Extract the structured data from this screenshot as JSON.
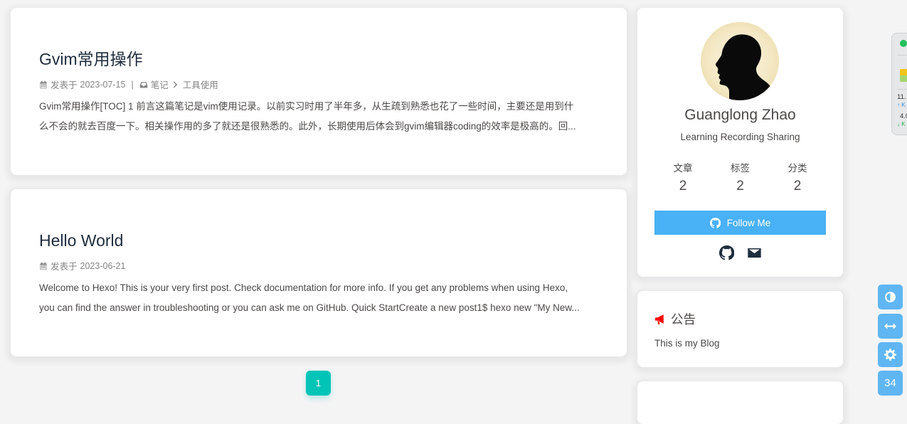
{
  "posts": [
    {
      "title": "Gvim常用操作",
      "meta_prefix": "发表于",
      "date": "2023-07-15",
      "separator": "|",
      "category": "笔记",
      "subcategory": "工具使用",
      "excerpt_line1": "Gvim常用操作[TOC] 1 前言这篇笔记是vim使用记录。以前实习时用了半年多，从生疏到熟悉也花了一些时间，主要还是用到什",
      "excerpt_line2": "么不会的就去百度一下。相关操作用的多了就还是很熟悉的。此外，长期使用后体会到gvim编辑器coding的效率是极高的。回..."
    },
    {
      "title": "Hello World",
      "meta_prefix": "发表于",
      "date": "2023-06-21",
      "excerpt_line1": "Welcome to Hexo! This is your very first post. Check documentation for more info. If you get any problems when using Hexo,",
      "excerpt_line2": "you can find the answer in troubleshooting or you can ask me on GitHub. Quick StartCreate a new post1$ hexo new \"My New..."
    }
  ],
  "pagination": {
    "current": "1"
  },
  "author": {
    "name": "Guanglong Zhao",
    "description": "Learning Recording Sharing",
    "stats": [
      {
        "label": "文章",
        "value": "2"
      },
      {
        "label": "标签",
        "value": "2"
      },
      {
        "label": "分类",
        "value": "2"
      }
    ],
    "follow_label": "Follow Me",
    "social": [
      "github-icon",
      "envelope-icon"
    ]
  },
  "announcement": {
    "title": "公告",
    "text": "This is my Blog"
  },
  "rightside": {
    "buttons": [
      "half-circle-icon",
      "arrows-h-icon",
      "cog-icon"
    ],
    "counter": "34"
  },
  "net_widget": {
    "upload_value": "11.",
    "upload_unit": "K",
    "download_value": "4.0",
    "download_unit": "K"
  },
  "colors": {
    "accent": "#49b1f5",
    "page_active": "#00c4b6",
    "announcement_icon": "#ff0000",
    "rightside": "#5fb6f2"
  }
}
